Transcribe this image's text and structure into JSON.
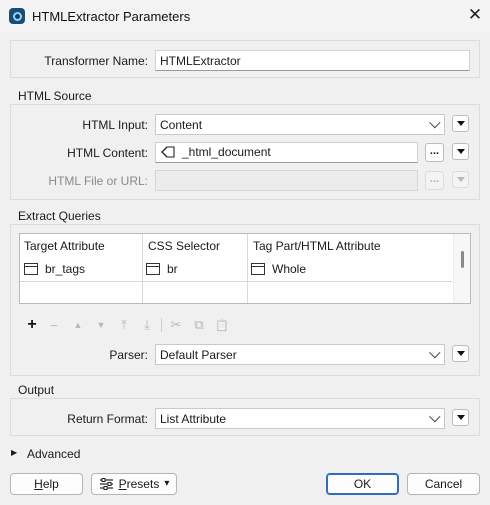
{
  "window": {
    "title": "HTMLExtractor Parameters",
    "close_glyph": "✕"
  },
  "transformer_name": {
    "label": "Transformer Name:",
    "value": "HTMLExtractor"
  },
  "html_source": {
    "legend": "HTML Source",
    "html_input": {
      "label": "HTML Input:",
      "value": "Content"
    },
    "html_content": {
      "label": "HTML Content:",
      "value": "_html_document",
      "ellipsis": "..."
    },
    "html_file": {
      "label": "HTML File or URL:",
      "value": "",
      "ellipsis": "..."
    }
  },
  "extract_queries": {
    "legend": "Extract Queries",
    "columns": [
      "Target Attribute",
      "CSS Selector",
      "Tag Part/HTML Attribute"
    ],
    "rows": [
      [
        "br_tags",
        "br",
        "Whole"
      ]
    ],
    "toolbar_glyphs": {
      "add": "+",
      "remove": "−",
      "move_up": "▲",
      "move_down": "▼",
      "move_top": "⤒",
      "move_bottom": "⤓",
      "cut": "✂",
      "copy": "⧉",
      "paste": "📋"
    },
    "parser": {
      "label": "Parser:",
      "value": "Default Parser"
    }
  },
  "output": {
    "legend": "Output",
    "return_format": {
      "label": "Return Format:",
      "value": "List Attribute"
    }
  },
  "advanced": {
    "label": "Advanced",
    "glyph": "▶"
  },
  "footer": {
    "help": "Help",
    "presets": "Presets",
    "presets_glyph": "▾",
    "ok": "OK",
    "cancel": "Cancel"
  }
}
